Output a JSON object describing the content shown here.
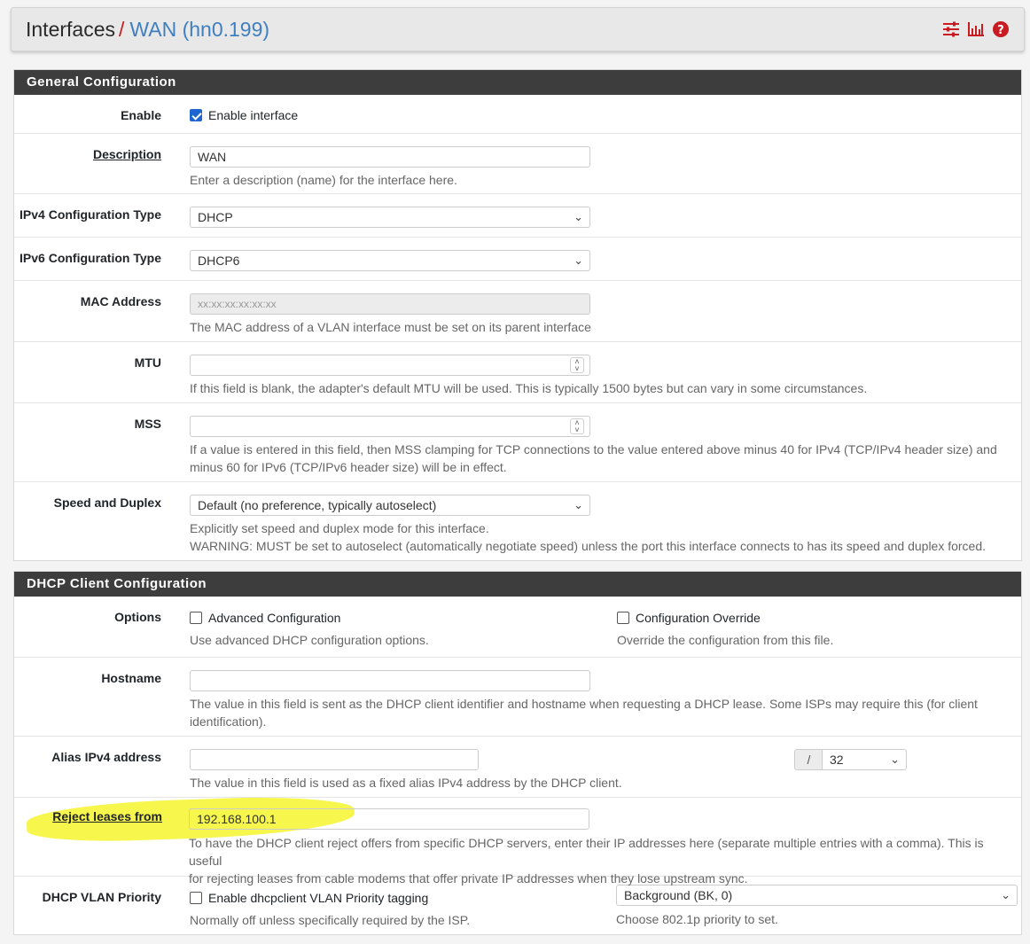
{
  "breadcrumb": {
    "section": "Interfaces",
    "separator": "/",
    "current": "WAN (hn0.199)",
    "icons": [
      "sliders-icon",
      "bar-chart-icon",
      "help-icon"
    ]
  },
  "general": {
    "heading": "General Configuration",
    "enable": {
      "label": "Enable",
      "checkbox_label": "Enable interface",
      "checked": true
    },
    "description": {
      "label": "Description",
      "value": "WAN",
      "help": "Enter a description (name) for the interface here."
    },
    "ipv4_type": {
      "label": "IPv4 Configuration Type",
      "value": "DHCP"
    },
    "ipv6_type": {
      "label": "IPv6 Configuration Type",
      "value": "DHCP6"
    },
    "mac": {
      "label": "MAC Address",
      "placeholder": "xx:xx:xx:xx:xx:xx",
      "help": "The MAC address of a VLAN interface must be set on its parent interface"
    },
    "mtu": {
      "label": "MTU",
      "value": "",
      "help": "If this field is blank, the adapter's default MTU will be used. This is typically 1500 bytes but can vary in some circumstances."
    },
    "mss": {
      "label": "MSS",
      "value": "",
      "help_line1": "If a value is entered in this field, then MSS clamping for TCP connections to the value entered above minus 40 for IPv4 (TCP/IPv4 header size) and",
      "help_line2": "minus 60 for IPv6 (TCP/IPv6 header size) will be in effect."
    },
    "speed": {
      "label": "Speed and Duplex",
      "value": "Default (no preference, typically autoselect)",
      "help_line1": "Explicitly set speed and duplex mode for this interface.",
      "help_line2": "WARNING: MUST be set to autoselect (automatically negotiate speed) unless the port this interface connects to has its speed and duplex forced."
    }
  },
  "dhcp": {
    "heading": "DHCP Client Configuration",
    "options": {
      "label": "Options",
      "advanced": {
        "label": "Advanced Configuration",
        "checked": false,
        "help": "Use advanced DHCP configuration options."
      },
      "override": {
        "label": "Configuration Override",
        "checked": false,
        "help": "Override the configuration from this file."
      }
    },
    "hostname": {
      "label": "Hostname",
      "value": "",
      "help_line1": "The value in this field is sent as the DHCP client identifier and hostname when requesting a DHCP lease. Some ISPs may require this (for client",
      "help_line2": "identification)."
    },
    "alias": {
      "label": "Alias IPv4 address",
      "value": "",
      "slash": "/",
      "cidr": "32",
      "help": "The value in this field is used as a fixed alias IPv4 address by the DHCP client."
    },
    "reject": {
      "label": "Reject leases from",
      "value": "192.168.100.1",
      "help_line1": "To have the DHCP client reject offers from specific DHCP servers, enter their IP addresses here (separate multiple entries with a comma). This is useful",
      "help_line2": "for rejecting leases from cable modems that offer private IP addresses when they lose upstream sync."
    },
    "vlan_priority": {
      "label": "DHCP VLAN Priority",
      "checkbox_label": "Enable dhcpclient VLAN Priority tagging",
      "checked": false,
      "help": "Normally off unless specifically required by the ISP.",
      "select_value": "Background (BK, 0)",
      "select_help": "Choose 802.1p priority to set."
    }
  },
  "colors": {
    "heading_bg": "#3d3d3d",
    "accent_red": "#c71c22",
    "link_blue": "#3f7fbf",
    "highlight": "#f5f542"
  }
}
